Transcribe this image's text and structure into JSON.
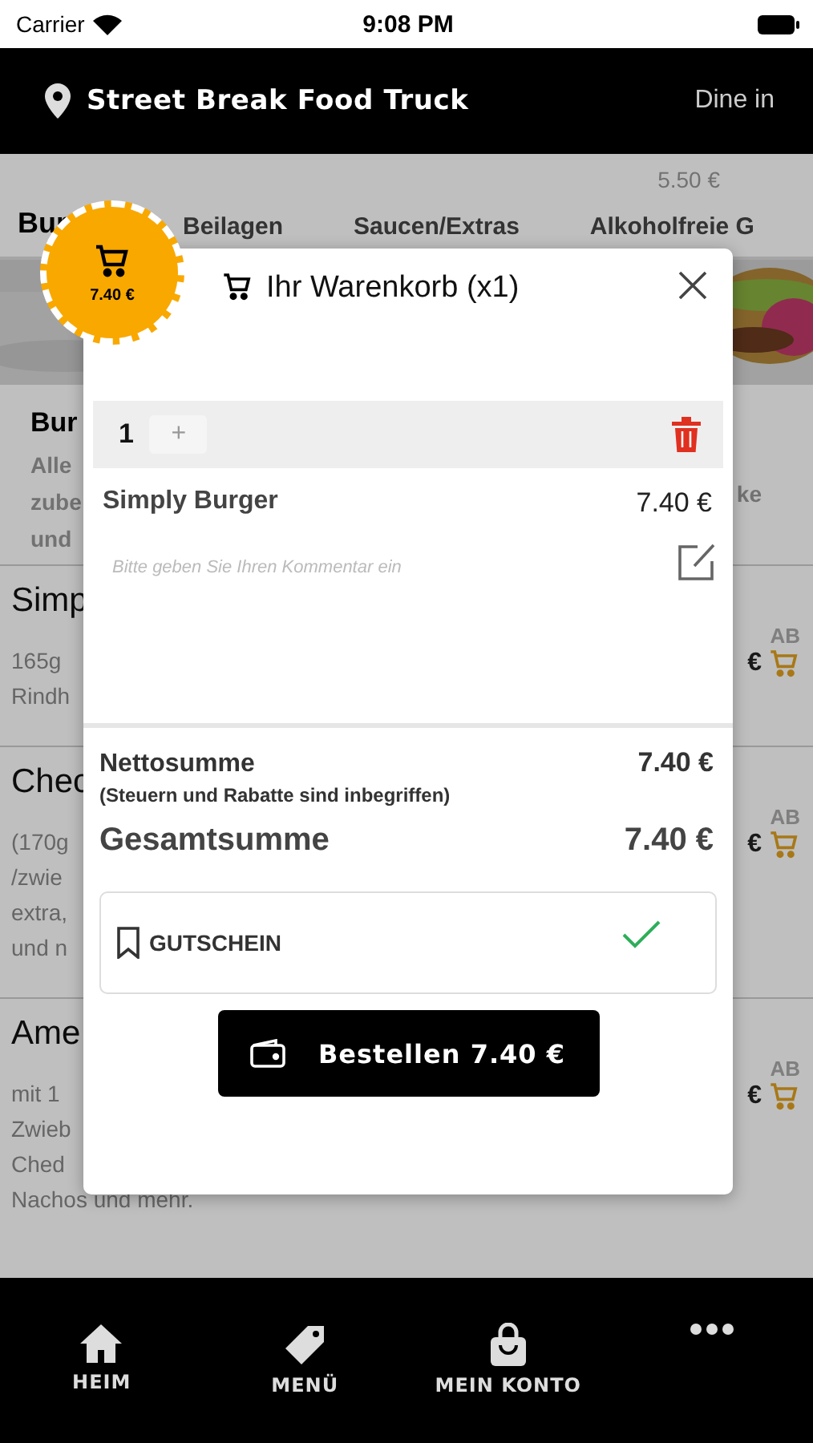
{
  "status_bar": {
    "carrier": "Carrier",
    "time": "9:08 PM"
  },
  "header": {
    "title": "Street Break Food Truck",
    "mode": "Dine in"
  },
  "ghost_price": "5.50 €",
  "tabs": [
    {
      "label": "Bur",
      "selected": true
    },
    {
      "label": "Beilagen",
      "selected": false
    },
    {
      "label": "Saucen/Extras",
      "selected": false
    },
    {
      "label": "Alkoholfreie G",
      "selected": false
    }
  ],
  "category": {
    "title": "Bur",
    "lines": [
      "Alle",
      "zube",
      "und"
    ],
    "tail": "ke"
  },
  "products": [
    {
      "name": "Simp",
      "lines": [
        "165g",
        "Rindh"
      ],
      "from": "AB",
      "price": "€"
    },
    {
      "name": "Chec",
      "lines": [
        "(170g",
        "/zwie",
        "extra,",
        "und n"
      ],
      "from": "AB",
      "price": "€"
    },
    {
      "name": "Ame",
      "lines": [
        "mit 1",
        "Zwieb",
        "Ched",
        "Nachos und mehr."
      ],
      "from": "AB",
      "price": "€"
    }
  ],
  "cart_badge": {
    "total": "7.40 €"
  },
  "cart": {
    "title": "Ihr Warenkorb (x1)",
    "quantity": "1",
    "plus": "+",
    "item": {
      "name": "Simply Burger",
      "price": "7.40 €"
    },
    "comment": {
      "placeholder": "Bitte geben Sie Ihren Kommentar ein"
    },
    "net_label": "Nettosumme",
    "net_value": "7.40 €",
    "net_note": "(Steuern und Rabatte sind inbegriffen)",
    "total_label": "Gesamtsumme",
    "total_value": "7.40 €",
    "voucher": {
      "label": "GUTSCHEIN",
      "applied": true
    },
    "order_button": "Bestellen 7.40 €"
  },
  "bottom_nav": [
    {
      "kind": "home",
      "label": "HEIM"
    },
    {
      "kind": "tag",
      "label": "MENÜ"
    },
    {
      "kind": "bag",
      "label": "MEIN KONTO"
    },
    {
      "kind": "more"
    }
  ]
}
